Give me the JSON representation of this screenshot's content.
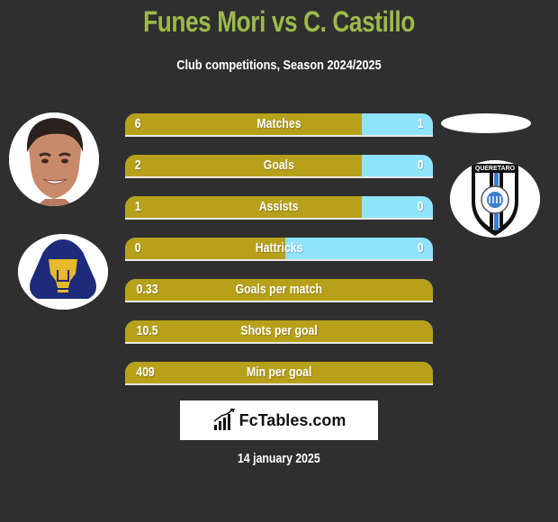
{
  "header": {
    "title": "Funes Mori vs C. Castillo",
    "subtitle": "Club competitions, Season 2024/2025"
  },
  "players": {
    "left": {
      "name": "Funes Mori",
      "photo_icon": "player-face",
      "club_icon": "pumas-unam-crest"
    },
    "right": {
      "name": "C. Castillo",
      "photo_icon": "blank-placeholder",
      "club_icon": "queretaro-crest",
      "club_crest_text": "QUERETARO"
    }
  },
  "colors": {
    "left_bar": "#b8a11a",
    "right_bar": "#8fe3fb",
    "title": "#9dba4a",
    "background": "#2f2f2f"
  },
  "stats": [
    {
      "label": "Matches",
      "left": "6",
      "right": "1",
      "left_share": 0.77
    },
    {
      "label": "Goals",
      "left": "2",
      "right": "0",
      "left_share": 0.77
    },
    {
      "label": "Assists",
      "left": "1",
      "right": "0",
      "left_share": 0.77
    },
    {
      "label": "Hattricks",
      "left": "0",
      "right": "0",
      "left_share": 0.52
    },
    {
      "label": "Goals per match",
      "left": "0.33",
      "right": "",
      "left_share": 1.0
    },
    {
      "label": "Shots per goal",
      "left": "10.5",
      "right": "",
      "left_share": 1.0
    },
    {
      "label": "Min per goal",
      "left": "409",
      "right": "",
      "left_share": 1.0
    }
  ],
  "footer": {
    "brand": "FcTables.com",
    "brand_icon": "bar-chart-icon",
    "date": "14 january 2025"
  }
}
